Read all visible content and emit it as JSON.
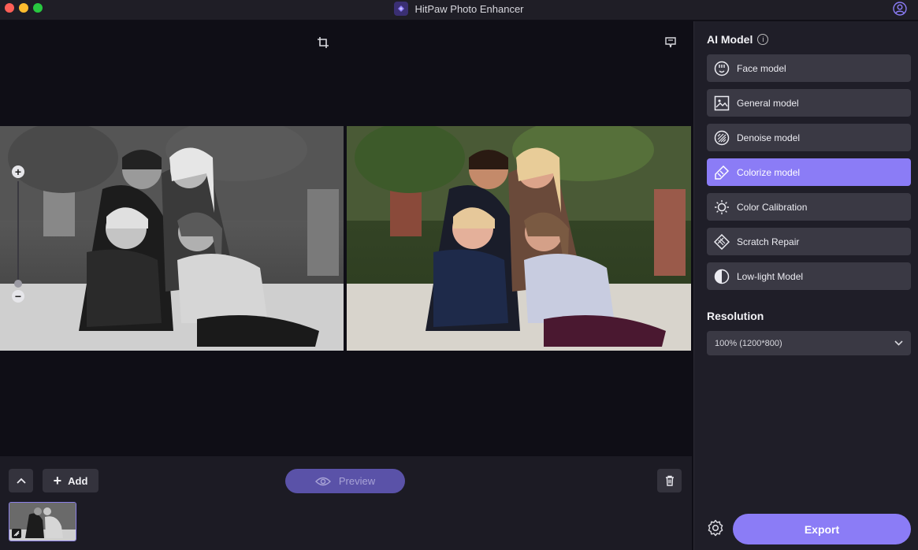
{
  "app": {
    "title": "HitPaw Photo Enhancer"
  },
  "canvas": {
    "icons": [
      "crop-icon",
      "feedback-icon",
      "zoom-in-icon",
      "zoom-out-icon"
    ]
  },
  "bottom_bar": {
    "add_label": "Add",
    "preview_label": "Preview"
  },
  "panel": {
    "ai_model_title": "AI Model",
    "models": [
      {
        "label": "Face model",
        "icon": "face-icon",
        "active": false
      },
      {
        "label": "General model",
        "icon": "image-icon",
        "active": false
      },
      {
        "label": "Denoise model",
        "icon": "denoise-icon",
        "active": false
      },
      {
        "label": "Colorize model",
        "icon": "colorize-icon",
        "active": true
      },
      {
        "label": "Color Calibration",
        "icon": "sun-icon",
        "active": false
      },
      {
        "label": "Scratch Repair",
        "icon": "scratch-icon",
        "active": false
      },
      {
        "label": "Low-light Model",
        "icon": "low-light-icon",
        "active": false
      }
    ],
    "resolution_title": "Resolution",
    "resolution_value": "100% (1200*800)",
    "export_label": "Export"
  },
  "colors": {
    "accent": "#8b7cf6",
    "panel_bg": "#1f1e28",
    "button_bg": "#3a3944",
    "canvas_bg": "#0f0e16"
  }
}
